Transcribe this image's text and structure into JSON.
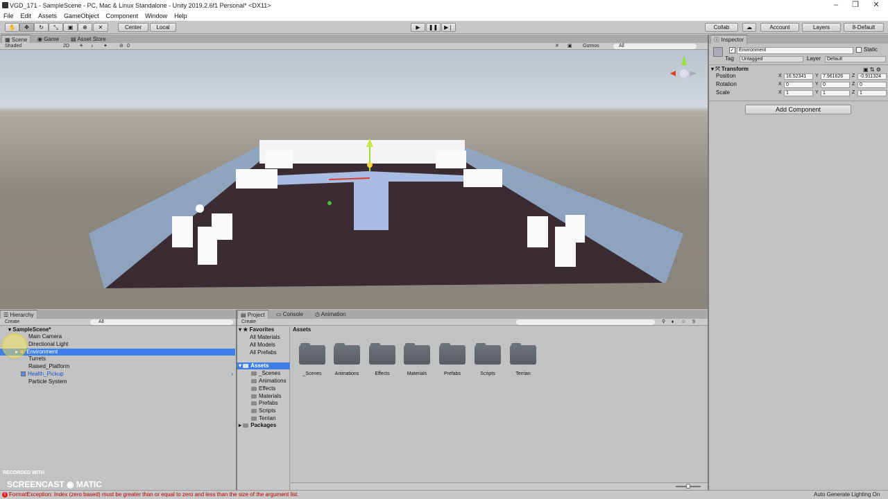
{
  "window": {
    "title": "VGD_171 - SampleScene - PC, Mac & Linux Standalone - Unity 2019.2.6f1 Personal* <DX11>"
  },
  "menu": [
    "File",
    "Edit",
    "Assets",
    "GameObject",
    "Component",
    "Window",
    "Help"
  ],
  "toolbar": {
    "pivot_label": "Center",
    "space_label": "Local",
    "collab_label": "Collab",
    "account_label": "Account",
    "layers_label": "Layers",
    "layout_label": "8-Default"
  },
  "scene_tabs": [
    "Scene",
    "Game",
    "Asset Store"
  ],
  "scene_bar": {
    "shading": "Shaded",
    "mode2d": "2D",
    "fx_count": "0",
    "gizmos": "Gizmos",
    "search": "All"
  },
  "hierarchy": {
    "tab": "Hierarchy",
    "create": "Create",
    "search": "All",
    "scene": "SampleScene*",
    "items": [
      "Main Camera",
      "Directional Light",
      "Environment",
      "Turrets",
      "Raised_Platform",
      "Health_Pickup",
      "Particle System"
    ],
    "selected": "Environment"
  },
  "project": {
    "tabs": [
      "Project",
      "Console",
      "Animation"
    ],
    "create": "Create",
    "favorites": "Favorites",
    "favorite_items": [
      "All Materials",
      "All Models",
      "All Prefabs"
    ],
    "assets_root": "Assets",
    "asset_folders": [
      "_Scenes",
      "Animations",
      "Effects",
      "Materials",
      "Prefabs",
      "Scripts",
      "Terrian"
    ],
    "packages": "Packages",
    "breadcrumb": "Assets",
    "badge_count": "9"
  },
  "inspector": {
    "tab": "Inspector",
    "object_name": "Environment",
    "static_label": "Static",
    "tag_label": "Tag",
    "tag_value": "Untagged",
    "layer_label": "Layer",
    "layer_value": "Default",
    "component": "Transform",
    "position_label": "Position",
    "rotation_label": "Rotation",
    "scale_label": "Scale",
    "axes": [
      "X",
      "Y",
      "Z"
    ],
    "position": [
      "16.52341",
      "7.961626",
      "-0.911324"
    ],
    "rotation": [
      "0",
      "0",
      "0"
    ],
    "scale": [
      "1",
      "1",
      "1"
    ],
    "add_component": "Add Component"
  },
  "status": {
    "error": "FormatException: Index (zero based) must be greater than or equal to zero and less than the size of the argument list.",
    "lighting": "Auto Generate Lighting On"
  },
  "watermark": {
    "line1": "RECORDED WITH",
    "line2a": "SCREENCAST",
    "line2b": "MATIC"
  },
  "colors": {
    "selection": "#3d7ee8",
    "floor": "#3b2b33",
    "walls": "#8ea8c8"
  }
}
